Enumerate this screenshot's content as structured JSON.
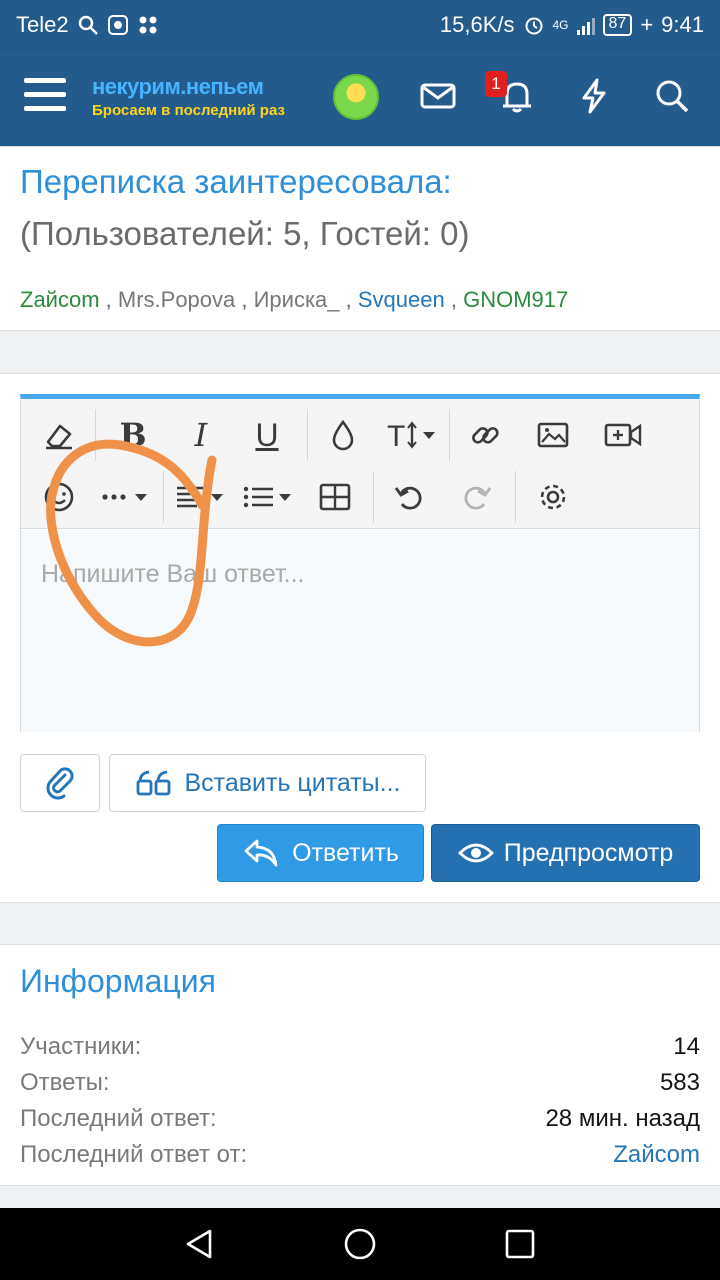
{
  "statusbar": {
    "carrier": "Tele2",
    "speed": "15,6K/s",
    "network": "4G",
    "battery": "87",
    "time": "9:41"
  },
  "header": {
    "logo_top": "некурим.непьем",
    "logo_bottom": "Бросаем в последний раз",
    "notifications_count": "1"
  },
  "reading": {
    "title": "Переписка заинтересовала:",
    "subtitle": "(Пользователей: 5, Гостей: 0)",
    "users": [
      "Zайcom",
      "Mrs.Popova",
      "Ириска_",
      "Svqueen",
      "GNOM917"
    ],
    "separator": " , "
  },
  "editor": {
    "placeholder": "Напишите Ваш ответ..."
  },
  "actions": {
    "quote_label": "Вставить цитаты...",
    "reply_label": "Ответить",
    "preview_label": "Предпросмотр"
  },
  "info": {
    "title": "Информация",
    "rows": [
      {
        "label": "Участники:",
        "value": "14"
      },
      {
        "label": "Ответы:",
        "value": "583"
      },
      {
        "label": "Последний ответ:",
        "value": "28 мин. назад"
      },
      {
        "label": "Последний ответ от:",
        "value": "Zайcom"
      }
    ]
  },
  "colors": {
    "header": "#235b8c",
    "accent": "#2f8fd8",
    "reply_button": "#2f9ae6",
    "preview_button": "#2470b1",
    "annotation": "#f0914a"
  }
}
